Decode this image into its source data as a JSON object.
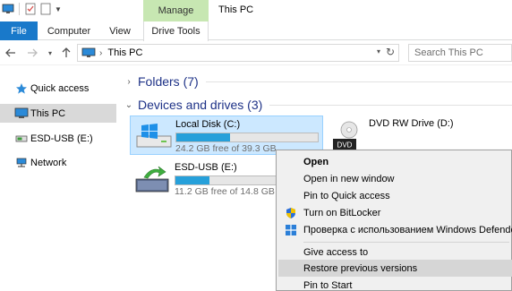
{
  "title_bar": {
    "context_tab": "Manage",
    "window_title": "This PC"
  },
  "ribbon": {
    "tabs": [
      "File",
      "Computer",
      "View",
      "Drive Tools"
    ]
  },
  "address": {
    "crumb": "This PC",
    "search_placeholder": "Search This PC"
  },
  "sidebar": {
    "items": [
      {
        "label": "Quick access",
        "icon": "star-icon"
      },
      {
        "label": "This PC",
        "icon": "computer-icon",
        "selected": true
      },
      {
        "label": "ESD-USB (E:)",
        "icon": "usb-drive-icon"
      },
      {
        "label": "Network",
        "icon": "network-icon"
      }
    ]
  },
  "main": {
    "folders_header": "Folders (7)",
    "devices_header": "Devices and drives (3)",
    "drives": [
      {
        "name": "Local Disk (C:)",
        "free_text": "24.2 GB free of 39.3 GB",
        "used_fraction": 0.38,
        "icon": "windows-drive-icon",
        "selected": true
      },
      {
        "name": "ESD-USB (E:)",
        "free_text": "11.2 GB free of 14.8 GB",
        "used_fraction": 0.24,
        "icon": "usb-setup-drive-icon"
      },
      {
        "name": "DVD RW Drive (D:)",
        "icon": "dvd-drive-icon"
      }
    ]
  },
  "context_menu": {
    "items": [
      {
        "label": "Open",
        "bold": true
      },
      {
        "label": "Open in new window"
      },
      {
        "label": "Pin to Quick access"
      },
      {
        "label": "Turn on BitLocker",
        "icon": "shield-icon"
      },
      {
        "label": "Проверка с использованием Windows Defender...",
        "icon": "defender-icon"
      },
      {
        "label": "Give access to"
      },
      {
        "label": "Restore previous versions",
        "hover": true
      },
      {
        "label": "Pin to Start"
      }
    ]
  },
  "colors": {
    "accent": "#1979ca",
    "manage_tab": "#c7e7b2",
    "selection": "#cce8ff",
    "bar_fill": "#26a0da",
    "group_title": "#1e3287"
  }
}
